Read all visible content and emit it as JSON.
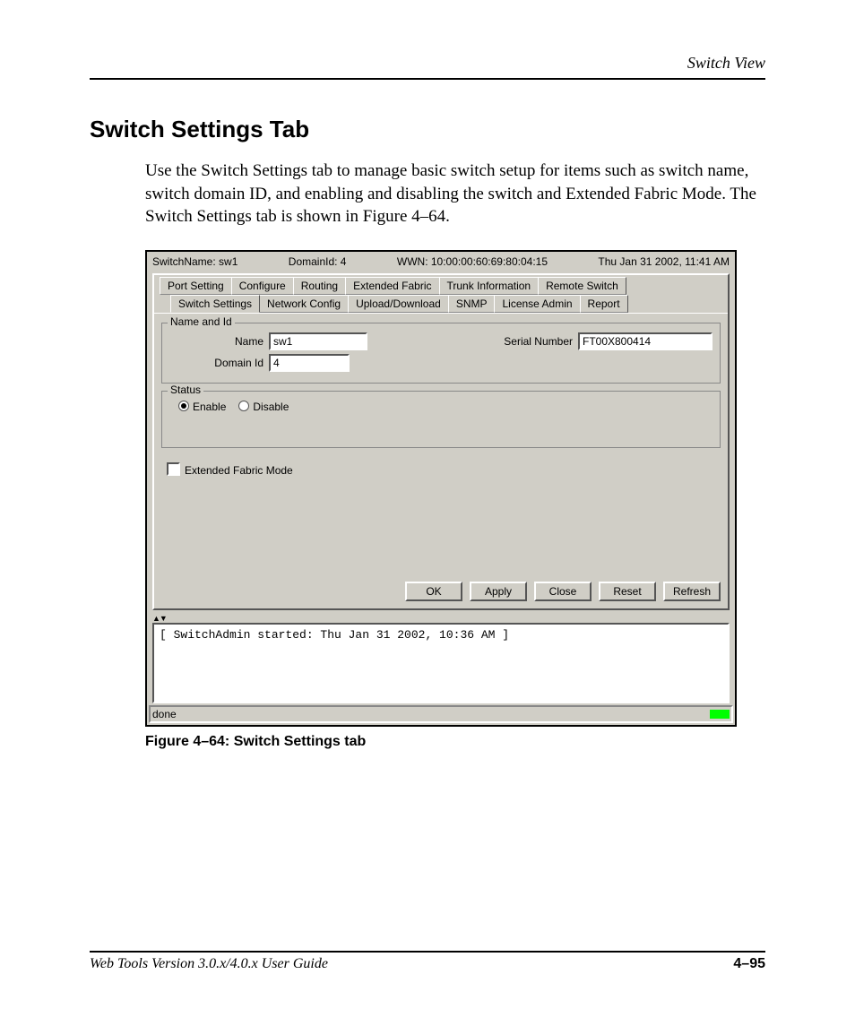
{
  "page": {
    "header": "Switch View",
    "section_title": "Switch Settings Tab",
    "body": "Use the Switch Settings tab to manage basic switch setup for items such as switch name, switch domain ID, and enabling and disabling the switch and Extended Fabric Mode. The Switch Settings tab is shown in Figure 4–64.",
    "figure_caption": "Figure 4–64:  Switch Settings tab",
    "footer_left": "Web Tools Version 3.0.x/4.0.x User Guide",
    "footer_right": "4–95"
  },
  "app": {
    "header": {
      "switch_name": "SwitchName: sw1",
      "domain": "DomainId: 4",
      "wwn": "WWN: 10:00:00:60:69:80:04:15",
      "time": "Thu Jan 31  2002, 11:41 AM"
    },
    "tabs_row1": [
      "Port Setting",
      "Configure",
      "Routing",
      "Extended Fabric",
      "Trunk Information",
      "Remote Switch"
    ],
    "tabs_row2": [
      "Switch Settings",
      "Network Config",
      "Upload/Download",
      "SNMP",
      "License Admin",
      "Report"
    ],
    "fieldset_name": {
      "legend": "Name and Id",
      "name_label": "Name",
      "name_value": "sw1",
      "domain_label": "Domain Id",
      "domain_value": "4",
      "serial_label": "Serial Number",
      "serial_value": "FT00X800414"
    },
    "fieldset_status": {
      "legend": "Status",
      "enable": "Enable",
      "disable": "Disable"
    },
    "ext_fabric_label": "Extended Fabric Mode",
    "buttons": {
      "ok": "OK",
      "apply": "Apply",
      "close": "Close",
      "reset": "Reset",
      "refresh": "Refresh"
    },
    "console": "[ SwitchAdmin started: Thu Jan 31  2002, 10:36 AM ]",
    "status": "done"
  }
}
